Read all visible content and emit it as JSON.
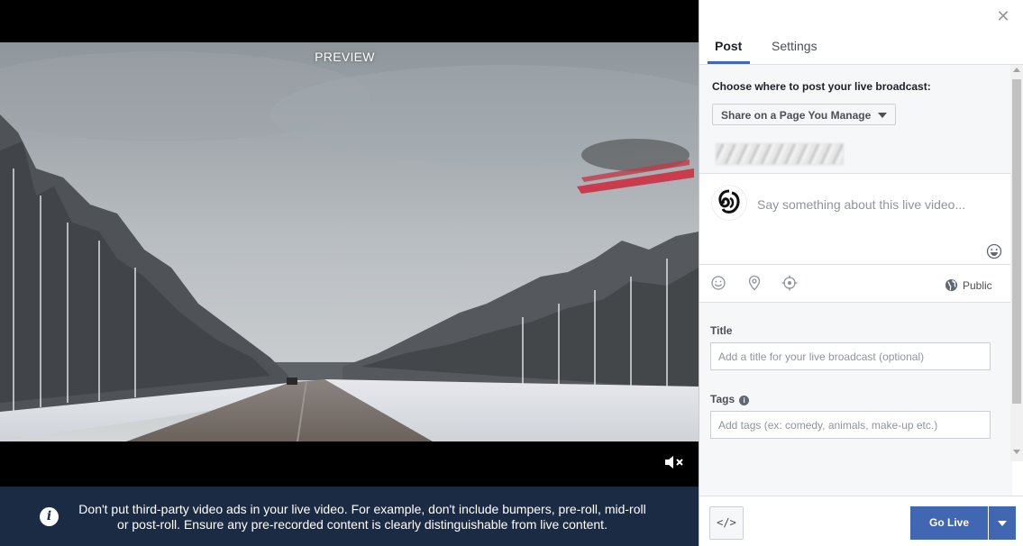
{
  "preview": {
    "label": "PREVIEW"
  },
  "notice": {
    "text": "Don't put third-party video ads in your live video. For example, don't include bumpers, pre-roll, mid-roll or post-roll. Ensure any pre-recorded content is clearly distinguishable from live content."
  },
  "tabs": [
    {
      "label": "Post",
      "active": true
    },
    {
      "label": "Settings",
      "active": false
    }
  ],
  "post": {
    "choose_label": "Choose where to post your live broadcast:",
    "share_option": "Share on a Page You Manage",
    "composer_placeholder": "Say something about this live video...",
    "audience": "Public",
    "title_label": "Title",
    "title_placeholder": "Add a title for your live broadcast (optional)",
    "tags_label": "Tags",
    "tags_placeholder": "Add tags (ex: comedy, animals, make-up etc.)"
  },
  "footer": {
    "embed_label": "</>",
    "go_live_label": "Go Live"
  },
  "colors": {
    "accent": "#4267b2",
    "notice_bg": "#1c2b44"
  },
  "icons": [
    "close-icon",
    "mute-icon",
    "info-icon",
    "emoji-icon",
    "feeling-icon",
    "location-icon",
    "target-icon",
    "globe-icon",
    "embed-icon",
    "chevron-down-icon"
  ]
}
